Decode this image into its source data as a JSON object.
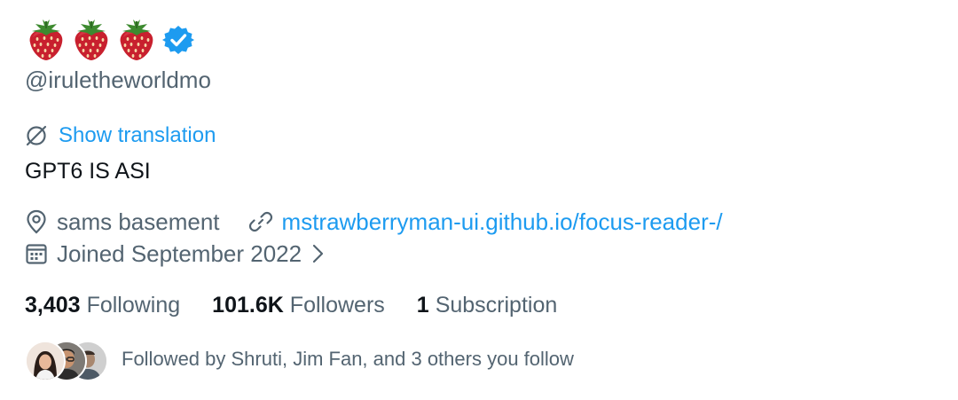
{
  "profile": {
    "display_name_icons": [
      "strawberry-emoji",
      "strawberry-emoji",
      "strawberry-emoji"
    ],
    "verified_icon": "verified-badge-icon",
    "handle": "@iruletheworldmo",
    "show_translation": "Show translation",
    "bio": "GPT6 IS ASI",
    "location": "sams basement",
    "website": "mstrawberryman-ui.github.io/focus-reader-/",
    "joined": "Joined September 2022",
    "stats": {
      "following_count": "3,403",
      "following_label": "Following",
      "followers_count": "101.6K",
      "followers_label": "Followers",
      "subscription_count": "1",
      "subscription_label": "Subscription"
    },
    "followed_by": "Followed by Shruti, Jim Fan, and 3 others you follow"
  },
  "colors": {
    "accent": "#1d9bf0",
    "secondary_text": "#536471",
    "primary_text": "#0f1419",
    "verified": "#1d9bf0"
  }
}
